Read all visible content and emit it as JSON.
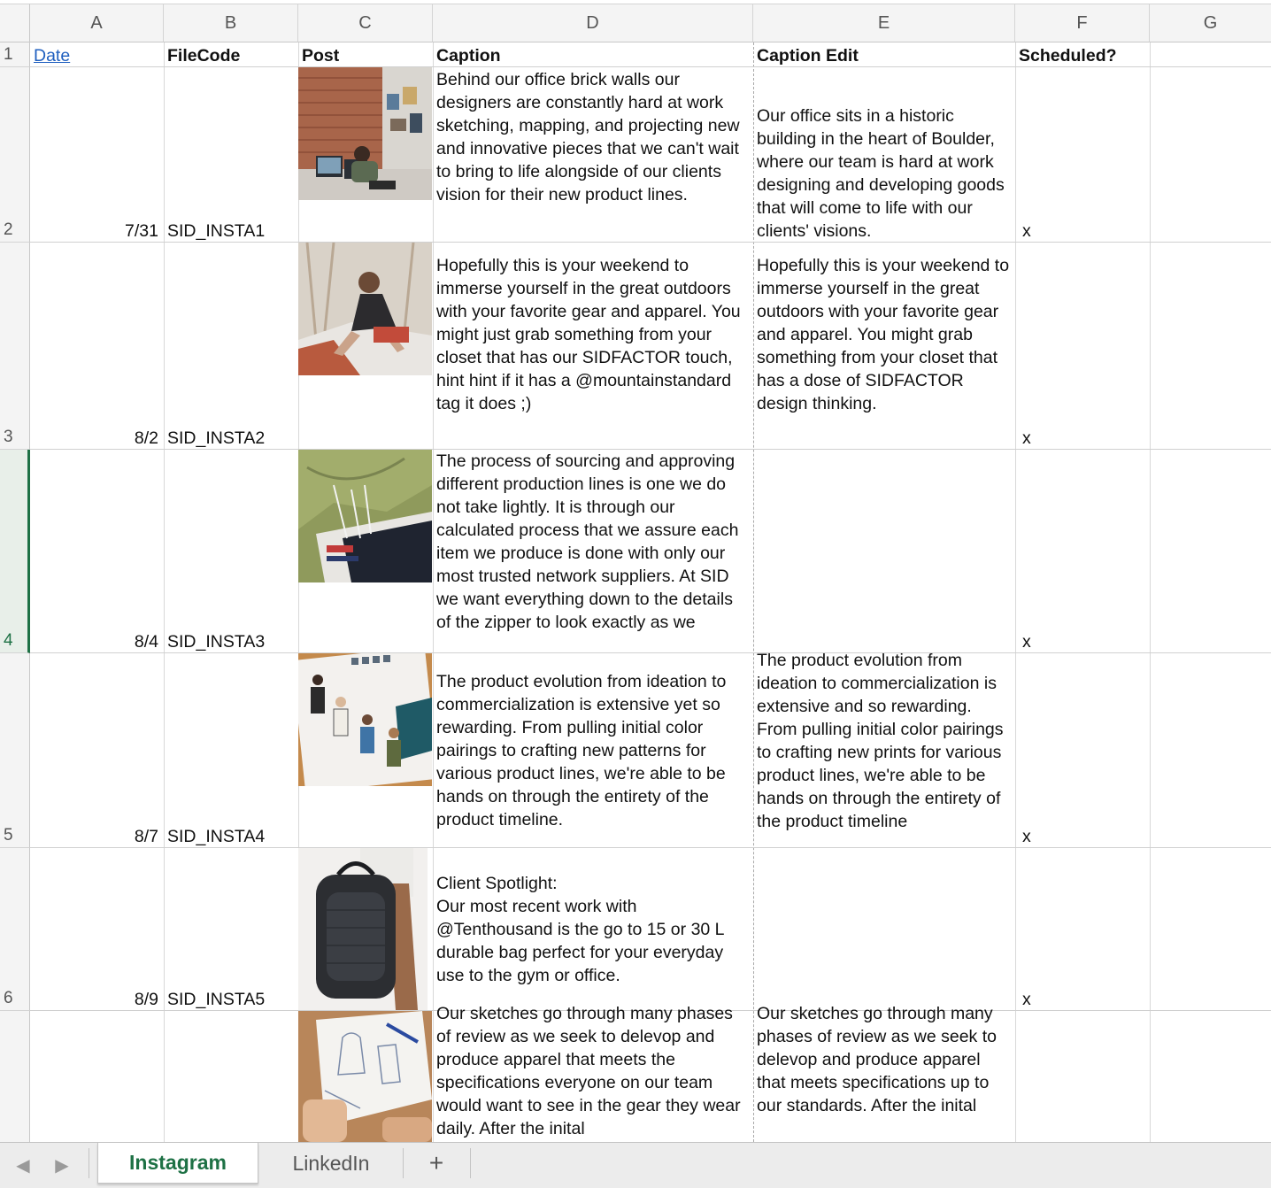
{
  "columns": [
    "A",
    "B",
    "C",
    "D",
    "E",
    "F",
    "G"
  ],
  "rows": [
    "1",
    "2",
    "3",
    "4",
    "5",
    "6"
  ],
  "header_row": {
    "date": "Date",
    "filecode": "FileCode",
    "post": "Post",
    "caption": "Caption",
    "caption_edit": "Caption Edit",
    "scheduled": "Scheduled?"
  },
  "records": [
    {
      "date": "7/31",
      "filecode": "SID_INSTA1",
      "caption": "Behind our office brick walls our designers are constantly hard at work sketching, mapping, and projecting new and innovative pieces that we can't wait to bring to life alongside of our clients vision for their new product lines.",
      "caption_edit": "Our office sits in a historic building in the heart of Boulder, where our team is hard at work designing and developing goods that will come to life with our clients' visions.",
      "scheduled": "x"
    },
    {
      "date": "8/2",
      "filecode": "SID_INSTA2",
      "caption": "Hopefully this is your weekend to immerse yourself in the great outdoors with your favorite gear and apparel. You might just grab something from your closet that has our SIDFACTOR touch, hint hint if it has a @mountainstandard tag it does ;)",
      "caption_edit": "Hopefully this is your weekend to immerse yourself in the great outdoors with your favorite gear and apparel. You might grab something from your closet that has a dose of SIDFACTOR design thinking.",
      "scheduled": "x"
    },
    {
      "date": "8/4",
      "filecode": "SID_INSTA3",
      "caption": "The process of sourcing and approving different production lines is one we do not take lightly. It is through our calculated process that we assure each item we produce is done with only our most trusted network suppliers. At SID we want everything down to the details of the zipper to look exactly as we",
      "caption_edit": "",
      "scheduled": "x"
    },
    {
      "date": "8/7",
      "filecode": "SID_INSTA4",
      "caption": "The product evolution from ideation to commercialization is extensive yet so rewarding. From pulling initial color pairings to crafting new patterns for various product lines, we're able to be hands on through the entirety of the product timeline.",
      "caption_edit": "The product evolution from ideation to commercialization is extensive and so rewarding. From pulling initial color pairings to crafting new prints for various product lines, we're able to be hands on through the entirety of the product timeline",
      "scheduled": "x"
    },
    {
      "date": "8/9",
      "filecode": "SID_INSTA5",
      "caption": "Client Spotlight:\nOur most recent work with @Tenthousand is the go to 15 or 30 L durable bag perfect for your everyday use to the gym or office.",
      "caption_edit": "",
      "scheduled": "x"
    },
    {
      "date": "",
      "filecode": "",
      "caption": "Our sketches go through many phases of review as we seek to delevop and produce apparel that meets the specifications everyone on our team would want to see in the gear they wear daily. After the inital",
      "caption_edit": "Our sketches go through many phases of review as we seek to delevop and produce apparel that meets specifications up to our standards. After the inital",
      "scheduled": ""
    }
  ],
  "sheet_tabs": {
    "active": "Instagram",
    "second": "LinkedIn",
    "add": "+"
  },
  "accent_color": "#1e7145",
  "icons": {
    "prev": "chevron-left-icon",
    "next": "chevron-right-icon",
    "add": "plus-icon"
  }
}
